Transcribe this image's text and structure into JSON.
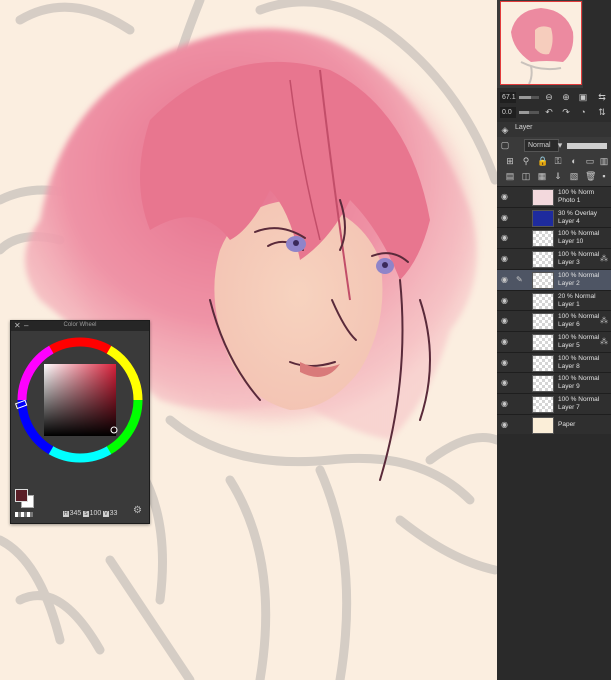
{
  "colors": {
    "canvas_bg": "#fbeee0",
    "hair": "#ec8aa0",
    "panel_bg": "#3a3a3a",
    "selected_layer_bg": "#4e5564",
    "current_color": "#5a1e27"
  },
  "color_wheel": {
    "title": "Color Wheel",
    "close_icon": "close-icon",
    "minimize_icon": "minimize-icon",
    "h_key": "H",
    "h_value": "345",
    "s_key": "S",
    "s_value": "100",
    "v_key": "V",
    "v_value": "33",
    "settings_icon": "gear-icon"
  },
  "navigator": {
    "zoom_value": "67.1",
    "angle_value": "0.0"
  },
  "layer_panel": {
    "tab_label": "Layer",
    "blend_mode": "Normal",
    "layers": [
      {
        "opacity": "100 %",
        "mode": "Norm",
        "name": "Photo 1",
        "thumb": "photo",
        "thumb_color": "#f3d9dd",
        "active": false,
        "pen": false,
        "ref": false
      },
      {
        "opacity": "30 %",
        "mode": "Overlay",
        "name": "Layer 4",
        "thumb": "fill",
        "thumb_color": "#1e2b9e",
        "active": false,
        "pen": false,
        "ref": false
      },
      {
        "opacity": "100 %",
        "mode": "Normal",
        "name": "Layer 10",
        "thumb": "checker",
        "thumb_color": "",
        "active": false,
        "pen": false,
        "ref": false
      },
      {
        "opacity": "100 %",
        "mode": "Normal",
        "name": "Layer 3",
        "thumb": "checker",
        "thumb_color": "",
        "active": false,
        "pen": false,
        "ref": true
      },
      {
        "opacity": "100 %",
        "mode": "Normal",
        "name": "Layer 2",
        "thumb": "checker",
        "thumb_color": "",
        "active": true,
        "pen": true,
        "ref": false
      },
      {
        "opacity": "20 %",
        "mode": "Normal",
        "name": "Layer 1",
        "thumb": "checker",
        "thumb_color": "",
        "active": false,
        "pen": false,
        "ref": false
      },
      {
        "opacity": "100 %",
        "mode": "Normal",
        "name": "Layer 6",
        "thumb": "checker",
        "thumb_color": "",
        "active": false,
        "pen": false,
        "ref": true
      },
      {
        "opacity": "100 %",
        "mode": "Normal",
        "name": "Layer 5",
        "thumb": "checker",
        "thumb_color": "",
        "active": false,
        "pen": false,
        "ref": true
      },
      {
        "opacity": "100 %",
        "mode": "Normal",
        "name": "Layer 8",
        "thumb": "checker",
        "thumb_color": "",
        "active": false,
        "pen": false,
        "ref": false
      },
      {
        "opacity": "100 %",
        "mode": "Normal",
        "name": "Layer 9",
        "thumb": "checker",
        "thumb_color": "",
        "active": false,
        "pen": false,
        "ref": false
      },
      {
        "opacity": "100 %",
        "mode": "Normal",
        "name": "Layer 7",
        "thumb": "checker",
        "thumb_color": "",
        "active": false,
        "pen": false,
        "ref": false
      },
      {
        "opacity": "",
        "mode": "",
        "name": "Paper",
        "thumb": "fill",
        "thumb_color": "#fbeed8",
        "active": false,
        "pen": false,
        "ref": false
      }
    ]
  }
}
